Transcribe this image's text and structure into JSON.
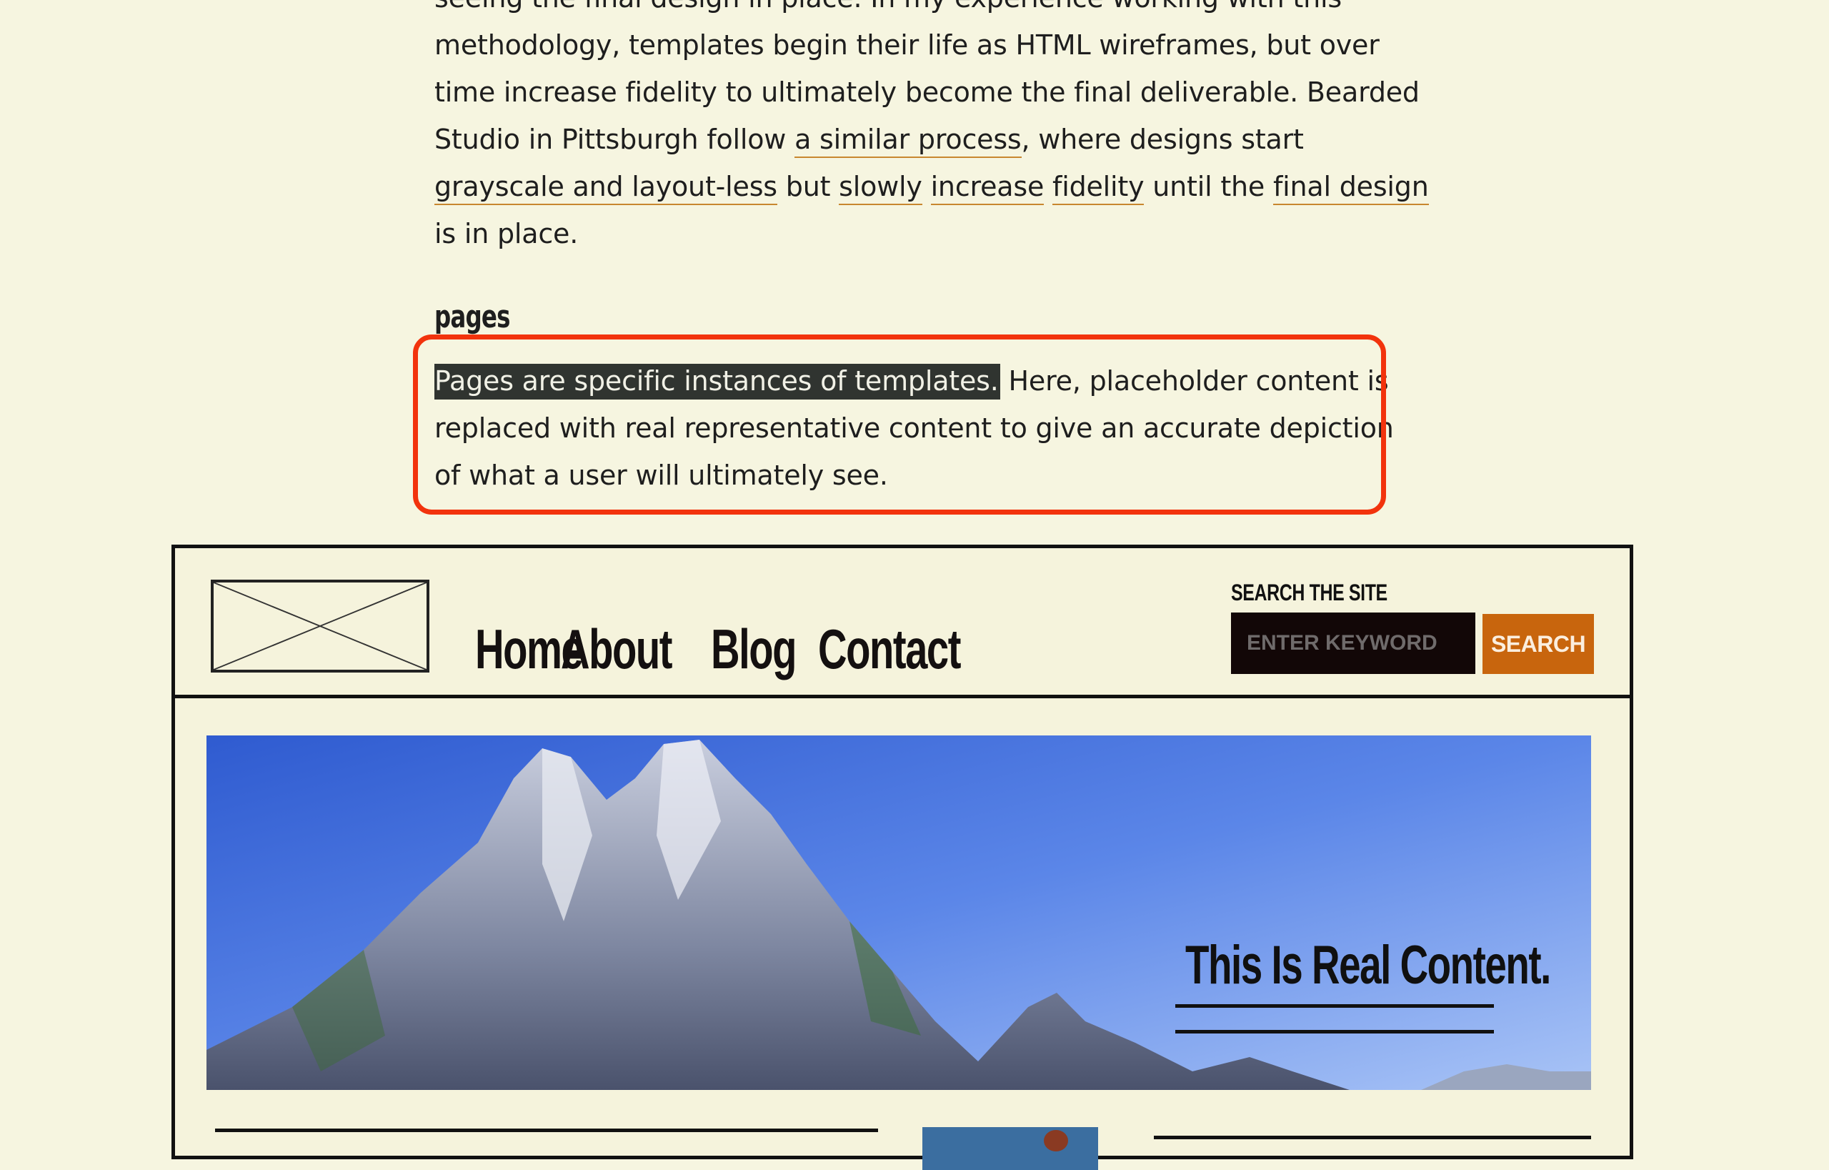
{
  "article": {
    "top_para": {
      "line0": "seeing the final design in place. In my experience working with this",
      "line1": "methodology, templates begin their life as HTML wireframes, but over",
      "line2": "time increase fidelity to ultimately become the final deliverable. Bearded",
      "line3a": "Studio in Pittsburgh follow ",
      "line3_link": "a similar process",
      "line3b": ", where designs start",
      "line4_link1": "grayscale and layout-less",
      "line4_mid1": " but ",
      "line4_link2": "slowly",
      "line4_sp1": " ",
      "line4_link3": "increase",
      "line4_sp2": " ",
      "line4_link4": "fidelity",
      "line4_mid2": " until the ",
      "line4_link5": "final design",
      "line5": "is in place."
    },
    "section_heading": "pages",
    "pages_para": {
      "highlighted": "Pages are specific instances of templates.",
      "line1_rest": " Here, placeholder content is",
      "line2": "replaced with real representative content to give an accurate depiction",
      "line3": "of what a user will ultimately see."
    }
  },
  "mock": {
    "nav": [
      "Home",
      "About",
      "Blog",
      "Contact"
    ],
    "search_label": "SEARCH THE SITE",
    "search_placeholder": "ENTER KEYWORD",
    "search_button": "SEARCH",
    "hero_title": "This Is Real Content."
  },
  "colors": {
    "background": "#f6f5e0",
    "link_underline": "#c8872f",
    "callout_border": "#f2330d",
    "search_button": "#c8650d",
    "highlight": "#303430"
  },
  "icons": {
    "logo_placeholder": "x-box-placeholder-icon"
  }
}
